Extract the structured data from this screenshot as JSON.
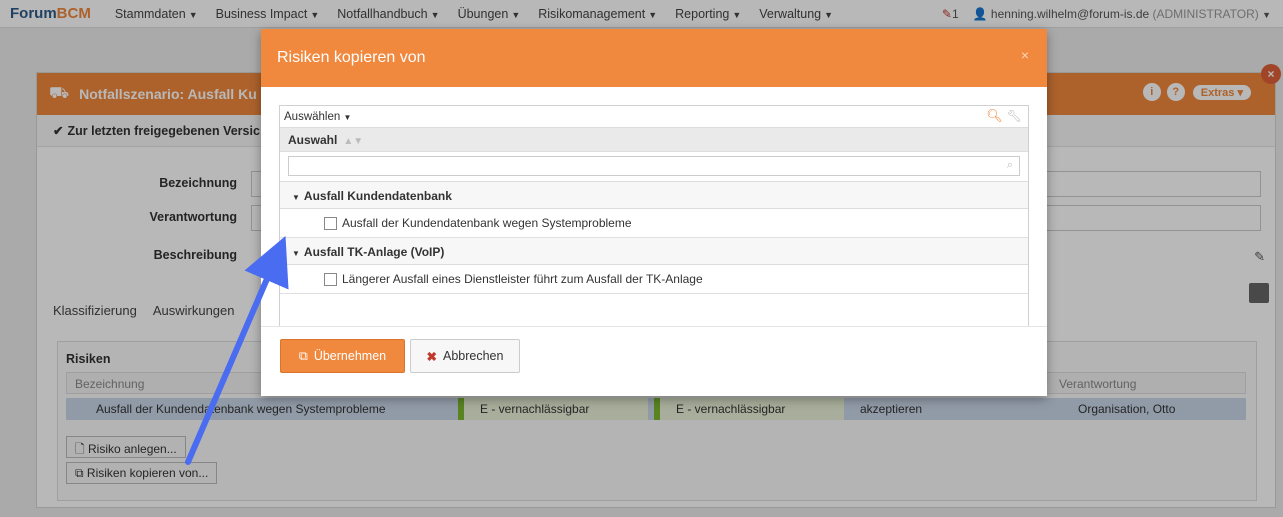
{
  "navbar": {
    "brand_a": "Forum",
    "brand_b": "BCM",
    "items": [
      "Stammdaten",
      "Business Impact",
      "Notfallhandbuch",
      "Übungen",
      "Risikomanagement",
      "Reporting",
      "Verwaltung"
    ],
    "edit_count": "1",
    "user": "henning.wilhelm@forum-is.de",
    "role": "(ADMINISTRATOR)"
  },
  "panel": {
    "title": "Notfallszenario: Ausfall Ku",
    "subbar": "Zur letzten freigegebenen Versic",
    "extras_label": "Extras",
    "labels": {
      "bezeichnung": "Bezeichnung",
      "verantwortung": "Verantwortung",
      "beschreibung": "Beschreibung"
    },
    "tabs": [
      "Klassifizierung",
      "Auswirkungen"
    ],
    "risks": {
      "title": "Risiken",
      "col_bezeichnung": "Bezeichnung",
      "col_verantwortung": "Verantwortung",
      "row": {
        "name": "Ausfall der Kundendatenbank wegen Systemprobleme",
        "c1": "E - vernachlässigbar",
        "c2": "E - vernachlässigbar",
        "c3": "akzeptieren",
        "owner": "Organisation, Otto"
      },
      "btn_create": "Risiko anlegen...",
      "btn_copy": "Risiken kopieren von..."
    }
  },
  "modal": {
    "title": "Risiken kopieren von",
    "select_label": "Auswählen",
    "column_header": "Auswahl",
    "groups": [
      {
        "label": "Ausfall Kundendatenbank",
        "items": [
          "Ausfall der Kundendatenbank wegen Systemprobleme"
        ]
      },
      {
        "label": "Ausfall TK-Anlage (VoIP)",
        "items": [
          "Längerer Ausfall eines Dienstleister führt zum Ausfall der TK-Anlage"
        ]
      }
    ],
    "apply_label": "Übernehmen",
    "cancel_label": "Abbrechen"
  },
  "colors": {
    "accent": "#f0883e",
    "arrow": "#4a6cf0",
    "success_bar": "#7cb82f"
  }
}
